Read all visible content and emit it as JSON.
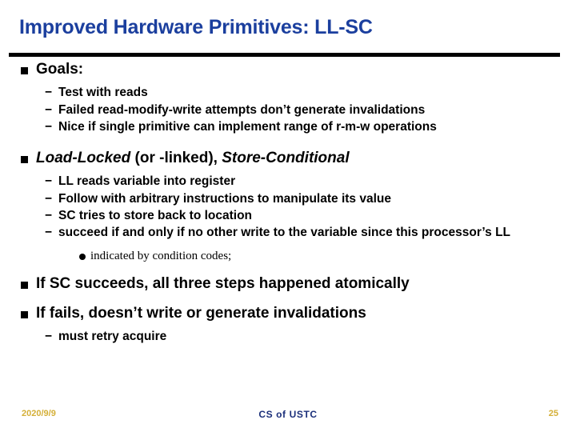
{
  "slide": {
    "title": "Improved Hardware Primitives: LL-SC",
    "title_color": "#1b3f9e",
    "rule_color": "#000000",
    "sections": [
      {
        "bullet_icon": "square-bullet-icon",
        "text": "Goals:",
        "sub": [
          {
            "bullet_icon": "dash-bullet-icon",
            "marker": "−",
            "text": "Test with reads"
          },
          {
            "bullet_icon": "dash-bullet-icon",
            "marker": "−",
            "text": "Failed read-modify-write attempts don’t generate invalidations"
          },
          {
            "bullet_icon": "dash-bullet-icon",
            "marker": "−",
            "text": "Nice if single primitive can implement range of r-m-w operations"
          }
        ]
      },
      {
        "bullet_icon": "square-bullet-icon",
        "text_parts": {
          "italic_1": "Load-Locked",
          "regular_1": " (or -linked), ",
          "italic_2": "Store-Conditional"
        },
        "sub": [
          {
            "bullet_icon": "dash-bullet-icon",
            "marker": "−",
            "text": "LL reads variable into register"
          },
          {
            "bullet_icon": "dash-bullet-icon",
            "marker": "−",
            "text": "Follow with arbitrary instructions to manipulate its value"
          },
          {
            "bullet_icon": "dash-bullet-icon",
            "marker": "−",
            "text": "SC tries to store back to location"
          },
          {
            "bullet_icon": "dash-bullet-icon",
            "marker": "−",
            "text": "succeed if and only if no other write to the variable since this processor’s LL"
          }
        ],
        "sub_sub": [
          {
            "bullet_icon": "round-bullet-icon",
            "text": "indicated by condition codes;"
          }
        ]
      },
      {
        "bullet_icon": "square-bullet-icon",
        "text": "If SC succeeds, all three steps happened atomically",
        "sub": []
      },
      {
        "bullet_icon": "square-bullet-icon",
        "text": "If fails, doesn’t write or generate invalidations",
        "sub": [
          {
            "bullet_icon": "dash-bullet-icon",
            "marker": "−",
            "text": "must retry acquire"
          }
        ]
      }
    ]
  },
  "footer": {
    "date": "2020/9/9",
    "center": "CS of USTC",
    "page": "25",
    "date_color": "#d4af37",
    "center_color": "#1b2f7a"
  }
}
